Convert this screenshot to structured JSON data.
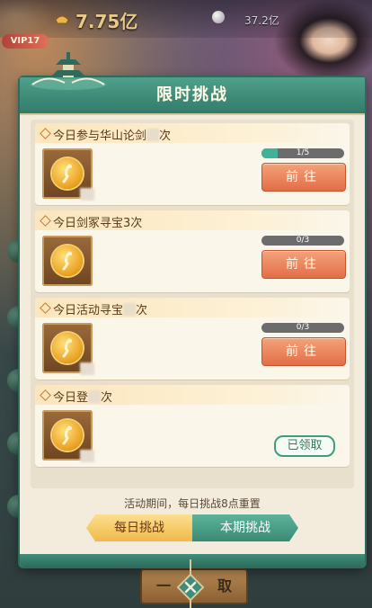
{
  "background": {
    "gold_amount": "7.75亿",
    "silver_amount": "37.2亿",
    "vip_label": "VIP17",
    "bottom_button": {
      "left": "一",
      "right": "取"
    }
  },
  "modal": {
    "title": "限时挑战",
    "tasks": [
      {
        "title": "今日参与华山论剑",
        "title_suffix": "次",
        "progress_text": "1/5",
        "progress": 0.2,
        "button": "前往",
        "state": "go"
      },
      {
        "title": "今日剑冢寻宝3次",
        "title_suffix": "",
        "progress_text": "0/3",
        "progress": 0,
        "button": "前往",
        "state": "go"
      },
      {
        "title": "今日活动寻宝",
        "title_suffix": "次",
        "progress_text": "0/3",
        "progress": 0,
        "button": "前往",
        "state": "go"
      },
      {
        "title": "今日登",
        "title_suffix": "次",
        "progress_text": "",
        "progress": 1,
        "button": "已领取",
        "state": "claimed"
      }
    ],
    "footer_note": "活动期间，每日挑战8点重置",
    "tabs": {
      "daily": "每日挑战",
      "period": "本期挑战",
      "active": "daily"
    }
  },
  "colors": {
    "header": "#3f8d79",
    "go_button": "#e26e48",
    "progress_fill": "#3fb39a",
    "tab_active": "#f1b84a"
  }
}
